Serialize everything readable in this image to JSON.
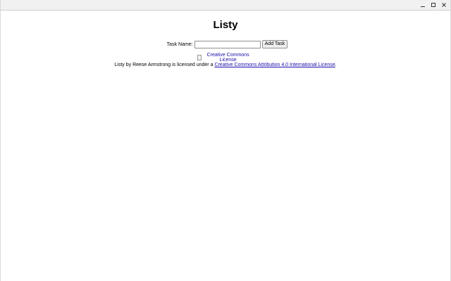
{
  "window": {
    "controls": {
      "minimize_icon": "minimize-icon",
      "maximize_icon": "maximize-icon",
      "close_icon": "close-icon"
    }
  },
  "app": {
    "title": "Listy",
    "task_label": "Task Name:",
    "task_input_value": "",
    "add_button_label": "Add Task"
  },
  "license": {
    "image_alt": "Creative Commons License",
    "prefix": "Listy by Reese Armstrong is licensed under a ",
    "link_text": "Creative Commons Attribution 4.0 International License",
    "suffix": "."
  },
  "colors": {
    "link": "#1a0dab",
    "titlebar": "#f1f1f1"
  }
}
